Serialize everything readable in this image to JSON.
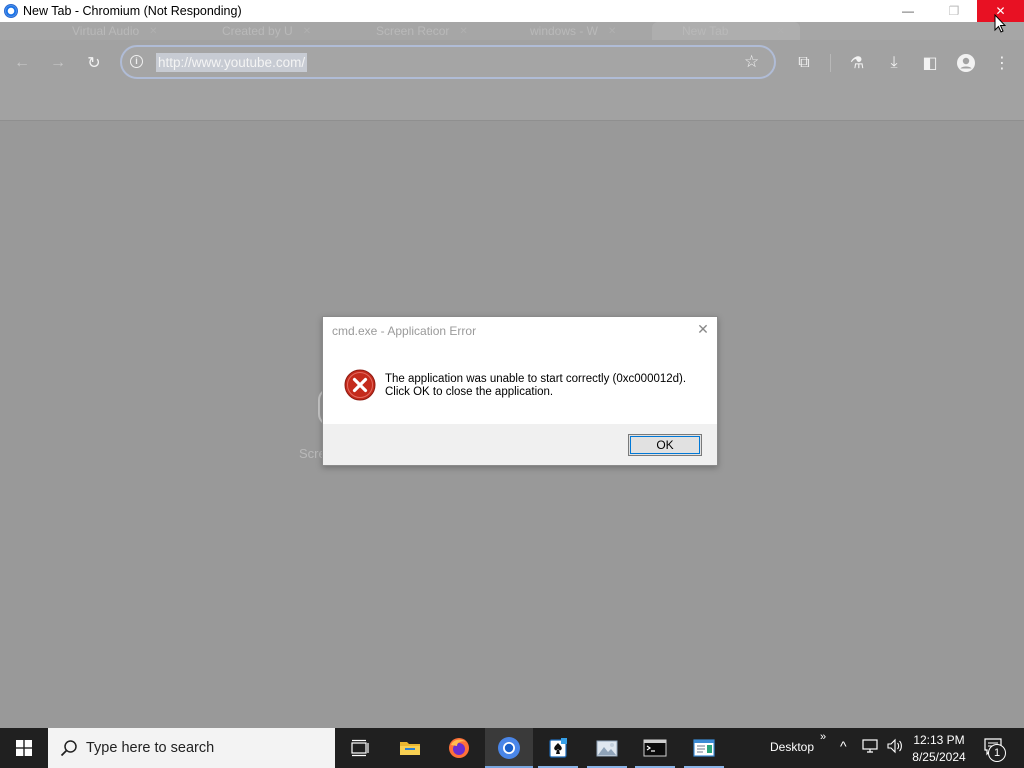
{
  "window": {
    "title": "New Tab - Chromium (Not Responding)",
    "minimize_glyph": "—",
    "maximize_glyph": "❐",
    "close_glyph": "✕"
  },
  "tabs": [
    {
      "label": "Virtual Audio",
      "active": false
    },
    {
      "label": "Created by U",
      "active": false
    },
    {
      "label": "Screen Recor",
      "active": false
    },
    {
      "label": "windows - W",
      "active": false
    },
    {
      "label": "New Tab",
      "active": true
    }
  ],
  "toolbar": {
    "back_glyph": "←",
    "forward_glyph": "→",
    "reload_glyph": "↻",
    "url": "http://www.youtube.com/",
    "star_glyph": "☆",
    "extensions_glyph": "⧉",
    "labs_glyph": "⚗",
    "download_glyph": "⤓",
    "sidepanel_glyph": "◧",
    "menu_glyph": "⋮"
  },
  "page": {
    "partial_text": "Scre"
  },
  "dialog": {
    "title": "cmd.exe - Application Error",
    "close_glyph": "✕",
    "message_line1": "The application was unable to start correctly (0xc000012d).",
    "message_line2": "Click OK to close the application.",
    "ok_label": "OK",
    "icon": "error-icon"
  },
  "taskbar": {
    "search_placeholder": "Type here to search",
    "desktop_label": "Desktop",
    "toolbar_chevron": "»",
    "tray_chevron": "^",
    "clock_time": "12:13 PM",
    "clock_date": "8/25/2024",
    "notification_count": "1",
    "apps": [
      "task-view",
      "file-explorer",
      "firefox",
      "chromium",
      "solitaire",
      "photos",
      "terminal",
      "notepad"
    ]
  },
  "colors": {
    "close_red": "#e81123",
    "taskbar": "#202020",
    "accent_blue": "#0078d7",
    "error_red": "#c42b1c"
  }
}
